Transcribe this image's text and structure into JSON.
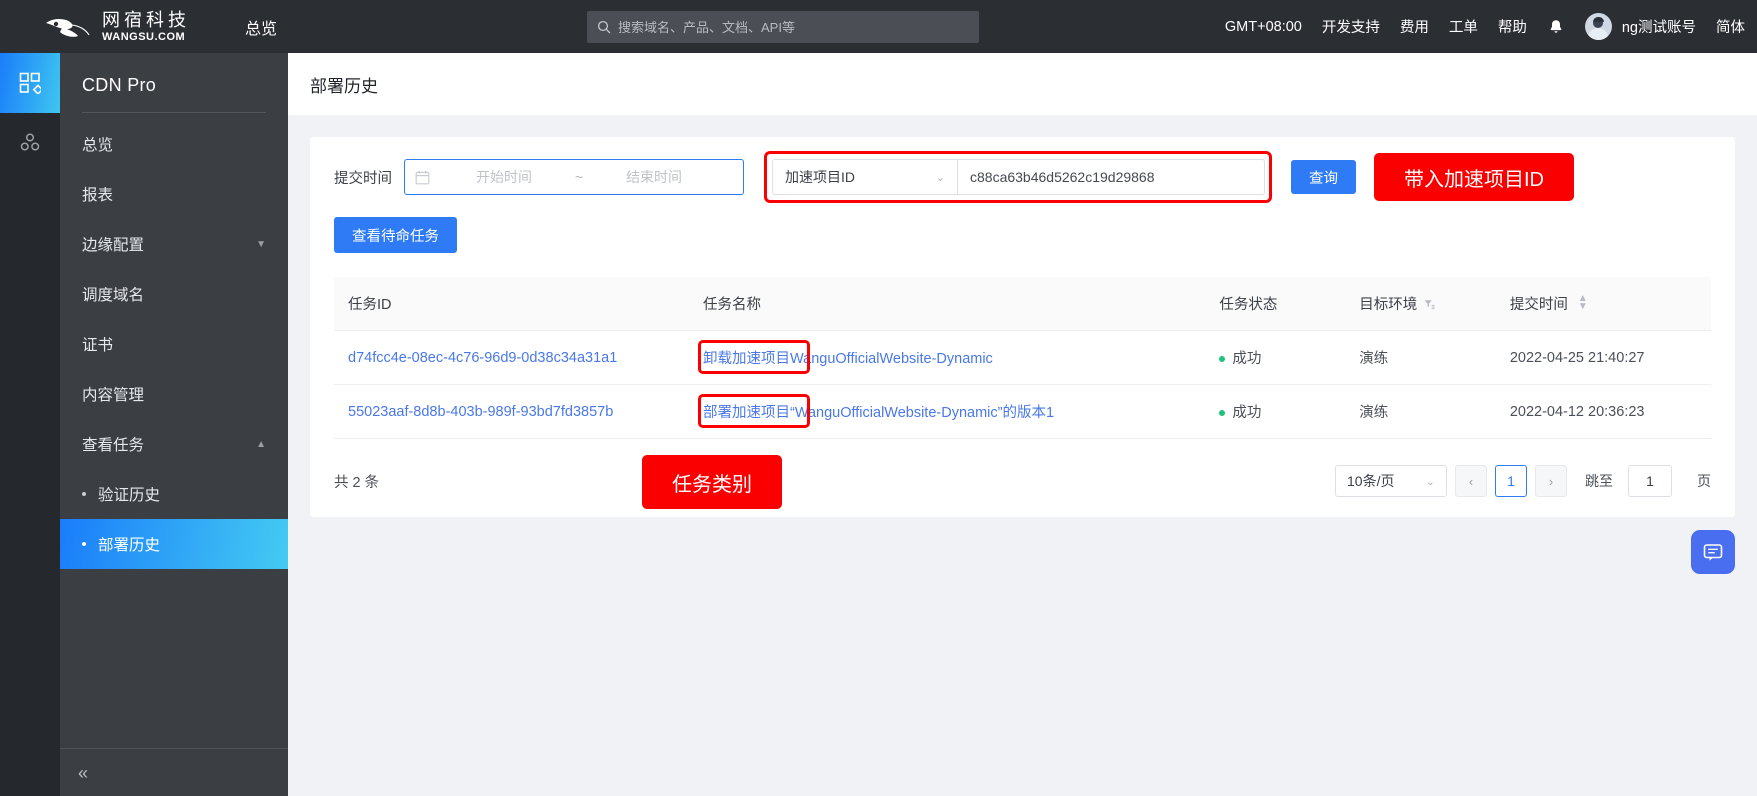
{
  "topbar": {
    "logo_cn": "网宿科技",
    "logo_en": "WANGSU.COM",
    "nav_overview": "总览",
    "search_placeholder": "搜索域名、产品、文档、API等",
    "search_value": "",
    "timezone": "GMT+08:00",
    "dev_support": "开发支持",
    "billing": "费用",
    "ticket": "工单",
    "help": "帮助",
    "user_name": "ng测试账号",
    "language": "简体"
  },
  "sidebar": {
    "title": "CDN Pro",
    "items": [
      {
        "label": "总览",
        "caret": ""
      },
      {
        "label": "报表",
        "caret": ""
      },
      {
        "label": "边缘配置",
        "caret": "▼"
      },
      {
        "label": "调度域名",
        "caret": ""
      },
      {
        "label": "证书",
        "caret": ""
      },
      {
        "label": "内容管理",
        "caret": ""
      },
      {
        "label": "查看任务",
        "caret": "▲"
      }
    ],
    "subitems": [
      {
        "label": "验证历史",
        "active": false
      },
      {
        "label": "部署历史",
        "active": true
      }
    ],
    "collapse": "«"
  },
  "page": {
    "title": "部署历史"
  },
  "filter": {
    "time_label": "提交时间",
    "start_placeholder": "开始时间",
    "start_value": "",
    "tilde": "~",
    "end_placeholder": "结束时间",
    "end_value": "",
    "select_value": "加速项目ID",
    "id_value": "c88ca63b46d5262c19d29868",
    "id_placeholder": "",
    "query_button": "查询",
    "annotation": "带入加速项目ID",
    "standby_button": "查看待命任务"
  },
  "table": {
    "columns": [
      {
        "key": "id",
        "label": "任务ID"
      },
      {
        "key": "name",
        "label": "任务名称"
      },
      {
        "key": "state",
        "label": "任务状态"
      },
      {
        "key": "env",
        "label": "目标环境"
      },
      {
        "key": "time",
        "label": "提交时间"
      }
    ],
    "rows": [
      {
        "id": "d74fcc4e-08ec-4c76-96d9-0d38c34a31a1",
        "name_prefix": "卸载加速项目",
        "name_rest": "WanguOfficialWebsite-Dynamic",
        "state": "成功",
        "env": "演练",
        "time": "2022-04-25 21:40:27"
      },
      {
        "id": "55023aaf-8d8b-403b-989f-93bd7fd3857b",
        "name_prefix": "部署加速项目",
        "name_rest": "“WanguOfficialWebsite-Dynamic”的版本1",
        "state": "成功",
        "env": "演练",
        "time": "2022-04-12 20:36:23"
      }
    ],
    "annotation": "任务类别"
  },
  "pagination": {
    "total": "共 2 条",
    "page_size": "10条/页",
    "prev": "‹",
    "next": "›",
    "current_page": "1",
    "jump_label": "跳至",
    "jump_value": "1",
    "jump_unit": "页"
  },
  "colors": {
    "accent": "#2f7bf6",
    "annotation_red": "#fb0000",
    "success_green": "#1fc47c",
    "sidebar_bg": "#3b3e43",
    "topbar_bg": "#2b2e33"
  }
}
